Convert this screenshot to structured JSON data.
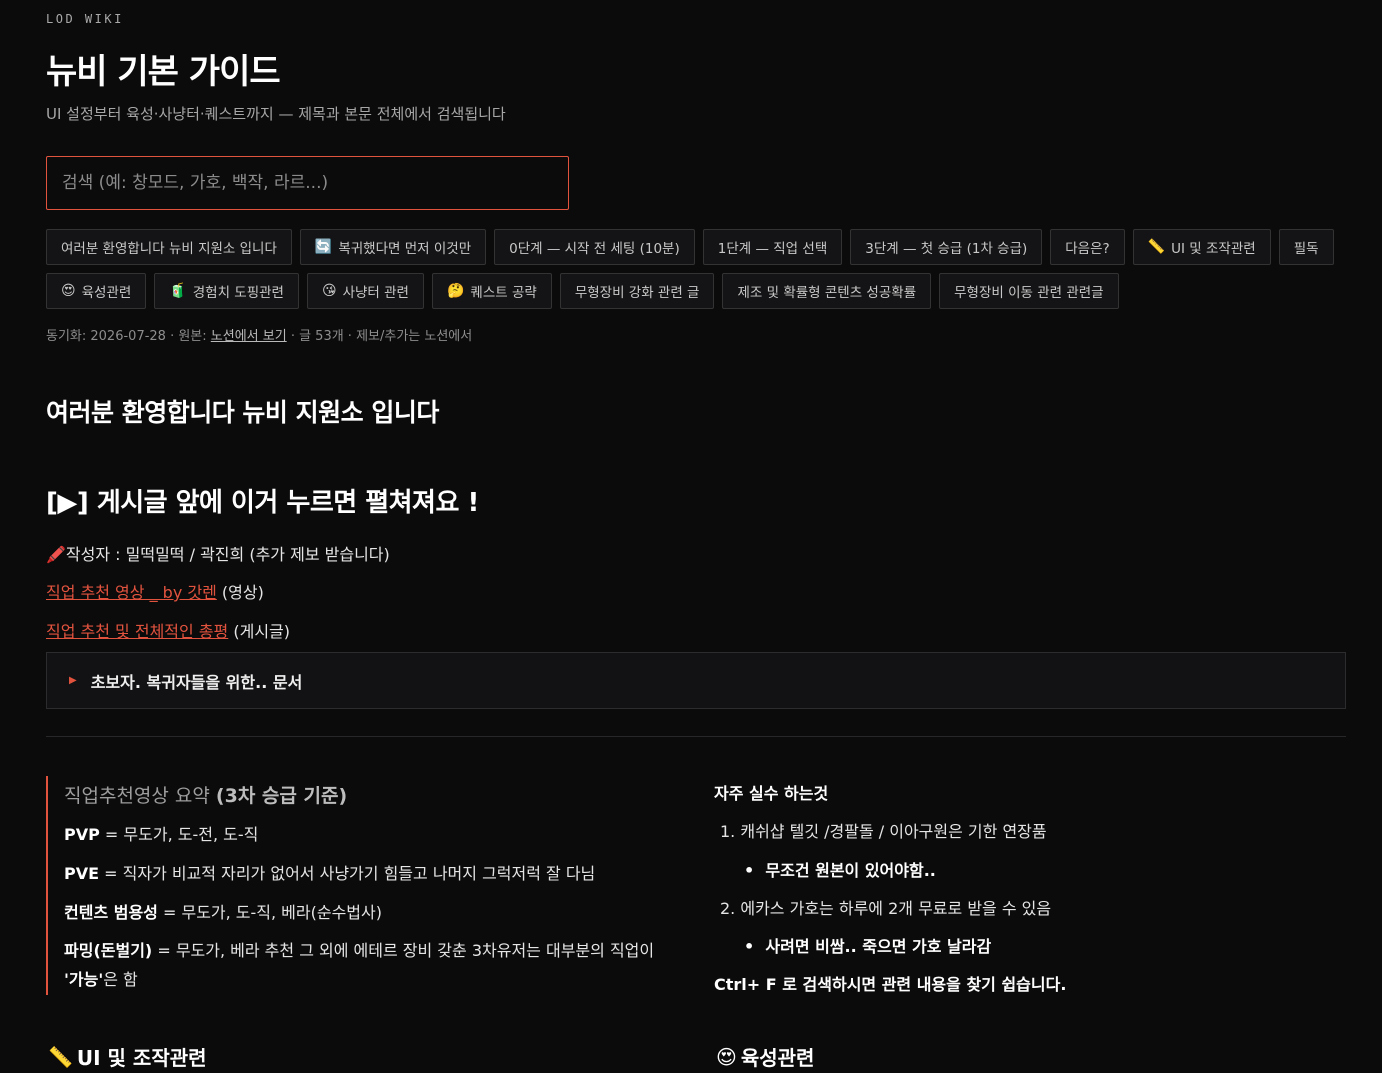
{
  "brand": "LOD WIKI",
  "title": "뉴비 기본 가이드",
  "subtitle": "UI 설정부터 육성·사냥터·퀘스트까지 — 제목과 본문 전체에서 검색됩니다",
  "search": {
    "placeholder": "검색 (예: 창모드, 가호, 백작, 라르...)",
    "value": ""
  },
  "chips": [
    {
      "icon": "",
      "label": "여러분 환영합니다 뉴비 지원소 입니다"
    },
    {
      "icon": "🔄",
      "label": "복귀했다면 먼저 이것만"
    },
    {
      "icon": "",
      "label": "0단계 — 시작 전 세팅 (10분)"
    },
    {
      "icon": "",
      "label": "1단계 — 직업 선택"
    },
    {
      "icon": "",
      "label": "3단계 — 첫 승급 (1차 승급)"
    },
    {
      "icon": "",
      "label": "다음은?"
    },
    {
      "icon": "📏",
      "label": "UI 및 조작관련"
    },
    {
      "icon": "",
      "label": "필독"
    },
    {
      "icon": "😍",
      "label": "육성관련"
    },
    {
      "icon": "🧃",
      "label": "경험치 도핑관련"
    },
    {
      "icon": "😘",
      "label": "사냥터 관련"
    },
    {
      "icon": "🤔",
      "label": "퀘스트 공략"
    },
    {
      "icon": "",
      "label": "무형장비 강화 관련 글"
    },
    {
      "icon": "",
      "label": "제조 및 확률형 콘텐츠 성공확률"
    },
    {
      "icon": "",
      "label": "무형장비 이동 관련 관련글"
    }
  ],
  "meta": {
    "sync_prefix": "동기화: 2026-07-28 · 원본: ",
    "source_link": "노션에서 보기",
    "suffix": " · 글 53개 · 제보/추가는 노션에서"
  },
  "content": {
    "welcome_heading": "여러분 환영합니다 뉴비 지원소 입니다",
    "toggle_hint_heading": "[▶] 게시글 앞에 이거 누르면 펼쳐져요 !",
    "author_line": "🖍️작성자 : 밀떡밀떡 / 곽진희 (추가 제보 받습니다)",
    "link1": {
      "text": "직업 추천 영상 _ by 갓렌",
      "suffix": " (영상)"
    },
    "link2": {
      "text": "직업 추천 및 전체적인 총평",
      "suffix": " (게시글)"
    },
    "toggle_label": "초보자. 복귀자들을 위한.. 문서"
  },
  "callout": {
    "title_plain": "직업추천영상 요약 ",
    "title_bold": "(3차 승급 기준)",
    "rows": [
      {
        "key": "PVP",
        "text": " = 무도가, 도-전, 도-직"
      },
      {
        "key": "PVE",
        "text": " = 직자가 비교적 자리가 없어서 사냥가기 힘들고 나머지 그럭저럭 잘 다님"
      },
      {
        "key": "컨텐츠 범용성",
        "text": " = 무도가, 도-직, 베라(순수법사)"
      },
      {
        "key": "파밍(돈벌기)",
        "text": " = 무도가, 베라 추천 그 외에 에테르 장비 갖춘 3차유저는 대부분의 직업이 ",
        "bold_tail": "'가능'",
        "tail": "은 함"
      }
    ]
  },
  "mistakes": {
    "title": "자주 실수 하는것",
    "item1": "1. 캐쉬샵 텔깃 /경팔돌 / 이아구원은 기한 연장품",
    "item1_sub": "무조건 원본이 있어야함..",
    "item2": "2. 에카스 가호는 하루에 2개 무료로 받을 수 있음",
    "item2_sub": "사려면 비쌈.. 죽으면 가호 날라감",
    "tip": "Ctrl+ F 로 검색하시면 관련 내용을 찾기 쉽습니다."
  },
  "sections": {
    "ui": {
      "icon": "📏",
      "label": "UI 및 조작관련"
    },
    "growth": {
      "icon": "😍",
      "label": "육성관련"
    }
  },
  "colors": {
    "accent": "#e2533e",
    "background": "#0b0b0c"
  }
}
